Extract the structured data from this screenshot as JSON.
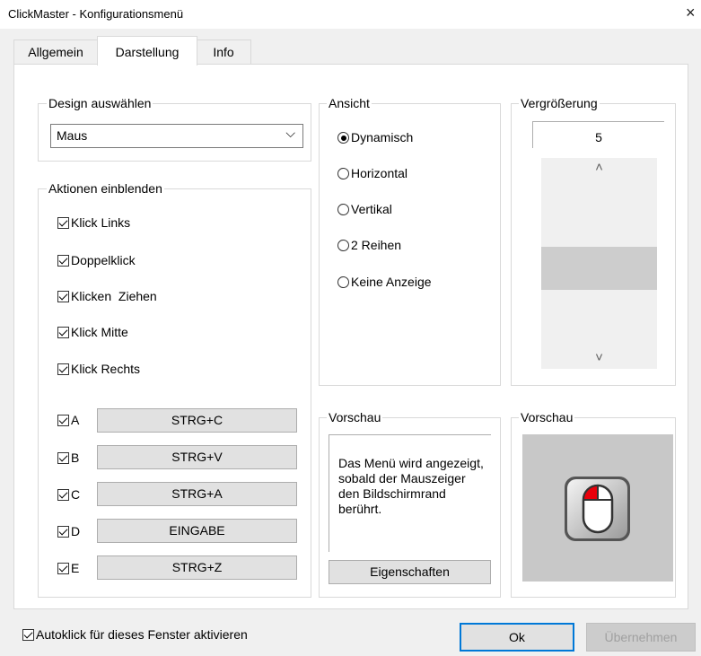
{
  "window": {
    "title": "ClickMaster - Konfigurationsmenü",
    "close_glyph": "×"
  },
  "tabs": [
    {
      "label": "Allgemein"
    },
    {
      "label": "Darstellung"
    },
    {
      "label": "Info"
    }
  ],
  "design": {
    "legend": "Design auswählen",
    "selected": "Maus",
    "chevron": "⌵"
  },
  "actions": {
    "legend": "Aktionen einblenden",
    "items": [
      {
        "label": "Klick Links",
        "checked": true
      },
      {
        "label": "Doppelklick",
        "checked": true
      },
      {
        "label": "Klicken  Ziehen",
        "checked": true
      },
      {
        "label": "Klick Mitte",
        "checked": true
      },
      {
        "label": "Klick Rechts",
        "checked": true
      }
    ],
    "hotkeys": [
      {
        "letter": "A",
        "checked": true,
        "value": "STRG+C"
      },
      {
        "letter": "B",
        "checked": true,
        "value": "STRG+V"
      },
      {
        "letter": "C",
        "checked": true,
        "value": "STRG+A"
      },
      {
        "letter": "D",
        "checked": true,
        "value": "EINGABE"
      },
      {
        "letter": "E",
        "checked": true,
        "value": "STRG+Z"
      }
    ]
  },
  "ansicht": {
    "legend": "Ansicht",
    "options": [
      {
        "label": "Dynamisch",
        "selected": true
      },
      {
        "label": "Horizontal",
        "selected": false
      },
      {
        "label": "Vertikal",
        "selected": false
      },
      {
        "label": "2 Reihen",
        "selected": false
      },
      {
        "label": "Keine Anzeige",
        "selected": false
      }
    ]
  },
  "zoom": {
    "legend": "Vergrößerung",
    "value": "5",
    "up": "˄",
    "down": "˅",
    "level_percent": 47
  },
  "preview_text": {
    "legend": "Vorschau",
    "text": "Das Menü wird angezeigt, sobald der Mauszeiger den Bildschirmrand berührt.",
    "button": "Eigenschaften"
  },
  "preview_image": {
    "legend": "Vorschau",
    "icon": "mouse-icon",
    "accent": "#e8000b"
  },
  "footer": {
    "autoclick_label": "Autoklick für dieses Fenster aktivieren",
    "autoclick_checked": true,
    "ok": "Ok",
    "apply": "Übernehmen"
  }
}
